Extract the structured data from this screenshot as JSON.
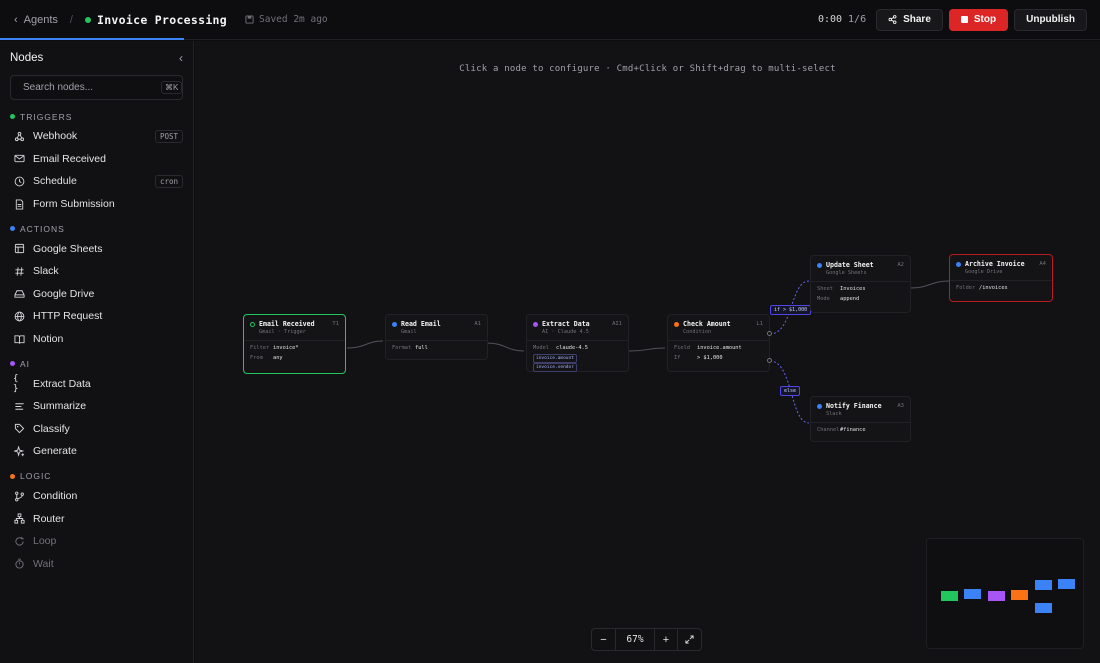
{
  "header": {
    "back_label": "Agents",
    "separator": "/",
    "title": "Invoice Processing",
    "saved": "Saved 2m ago",
    "timer": "0:00",
    "step": "1/6",
    "share_label": "Share",
    "stop_label": "Stop",
    "unpublish_label": "Unpublish"
  },
  "sidebar": {
    "title": "Nodes",
    "search": {
      "placeholder": "Search nodes...",
      "shortcut": "⌘K"
    },
    "categories": [
      {
        "label": "TRIGGERS",
        "color": "#22c55e",
        "items": [
          {
            "label": "Webhook",
            "icon": "webhook-icon",
            "tag": "POST"
          },
          {
            "label": "Email Received",
            "icon": "mail-icon"
          },
          {
            "label": "Schedule",
            "icon": "clock-icon",
            "tag": "cron"
          },
          {
            "label": "Form Submission",
            "icon": "form-icon"
          }
        ]
      },
      {
        "label": "ACTIONS",
        "color": "#3b82f6",
        "items": [
          {
            "label": "Google Sheets",
            "icon": "sheet-icon"
          },
          {
            "label": "Slack",
            "icon": "hash-icon"
          },
          {
            "label": "Google Drive",
            "icon": "drive-icon"
          },
          {
            "label": "HTTP Request",
            "icon": "globe-icon"
          },
          {
            "label": "Notion",
            "icon": "book-icon"
          }
        ]
      },
      {
        "label": "AI",
        "color": "#a855f7",
        "items": [
          {
            "label": "Extract Data",
            "icon": "braces-icon"
          },
          {
            "label": "Summarize",
            "icon": "lines-icon"
          },
          {
            "label": "Classify",
            "icon": "tag-icon"
          },
          {
            "label": "Generate",
            "icon": "sparkle-icon"
          }
        ]
      },
      {
        "label": "LOGIC",
        "color": "#f97316",
        "items": [
          {
            "label": "Condition",
            "icon": "branch-icon"
          },
          {
            "label": "Router",
            "icon": "router-icon"
          },
          {
            "label": "Loop",
            "icon": "loop-icon",
            "dim": true
          },
          {
            "label": "Wait",
            "icon": "timer-icon",
            "dim": true
          }
        ]
      }
    ]
  },
  "canvas": {
    "hint": "Click a node to configure · Cmd+Click or Shift+drag to multi-select",
    "nodes": {
      "email_received": {
        "title": "Email Received",
        "id": "T1",
        "subtitle": "Gmail · Trigger",
        "rows": [
          [
            "Filter",
            "invoice*"
          ],
          [
            "From",
            "any"
          ]
        ]
      },
      "read_email": {
        "title": "Read Email",
        "id": "A1",
        "subtitle": "Gmail",
        "rows": [
          [
            "Format",
            "full"
          ]
        ]
      },
      "extract_data": {
        "title": "Extract Data",
        "id": "AI1",
        "subtitle": "AI · Claude 4.5",
        "rows": [
          [
            "Model",
            "claude-4.5"
          ]
        ],
        "chips": [
          "invoice.amount",
          "invoice.vendor"
        ]
      },
      "check_amount": {
        "title": "Check Amount",
        "id": "L1",
        "subtitle": "Condition",
        "rows": [
          [
            "Field",
            "invoice.amount"
          ],
          [
            "If",
            "> $1,000"
          ]
        ]
      },
      "update_sheet": {
        "title": "Update Sheet",
        "id": "A2",
        "subtitle": "Google Sheets",
        "rows": [
          [
            "Sheet",
            "Invoices"
          ],
          [
            "Mode",
            "append"
          ]
        ]
      },
      "archive_invoice": {
        "title": "Archive Invoice",
        "id": "A4",
        "subtitle": "Google Drive",
        "rows": [
          [
            "Folder",
            "/invoices"
          ]
        ]
      },
      "notify_finance": {
        "title": "Notify Finance",
        "id": "A3",
        "subtitle": "Slack",
        "rows": [
          [
            "Channel",
            "#finance"
          ]
        ]
      }
    },
    "edge_labels": {
      "if": "if > $1,000",
      "else": "else"
    },
    "zoom": {
      "minus": "−",
      "value": "67%",
      "plus": "+"
    }
  },
  "colors": {
    "trigger": "#22c55e",
    "action": "#3b82f6",
    "ai": "#a855f7",
    "logic": "#f97316",
    "danger": "#dc2626"
  }
}
